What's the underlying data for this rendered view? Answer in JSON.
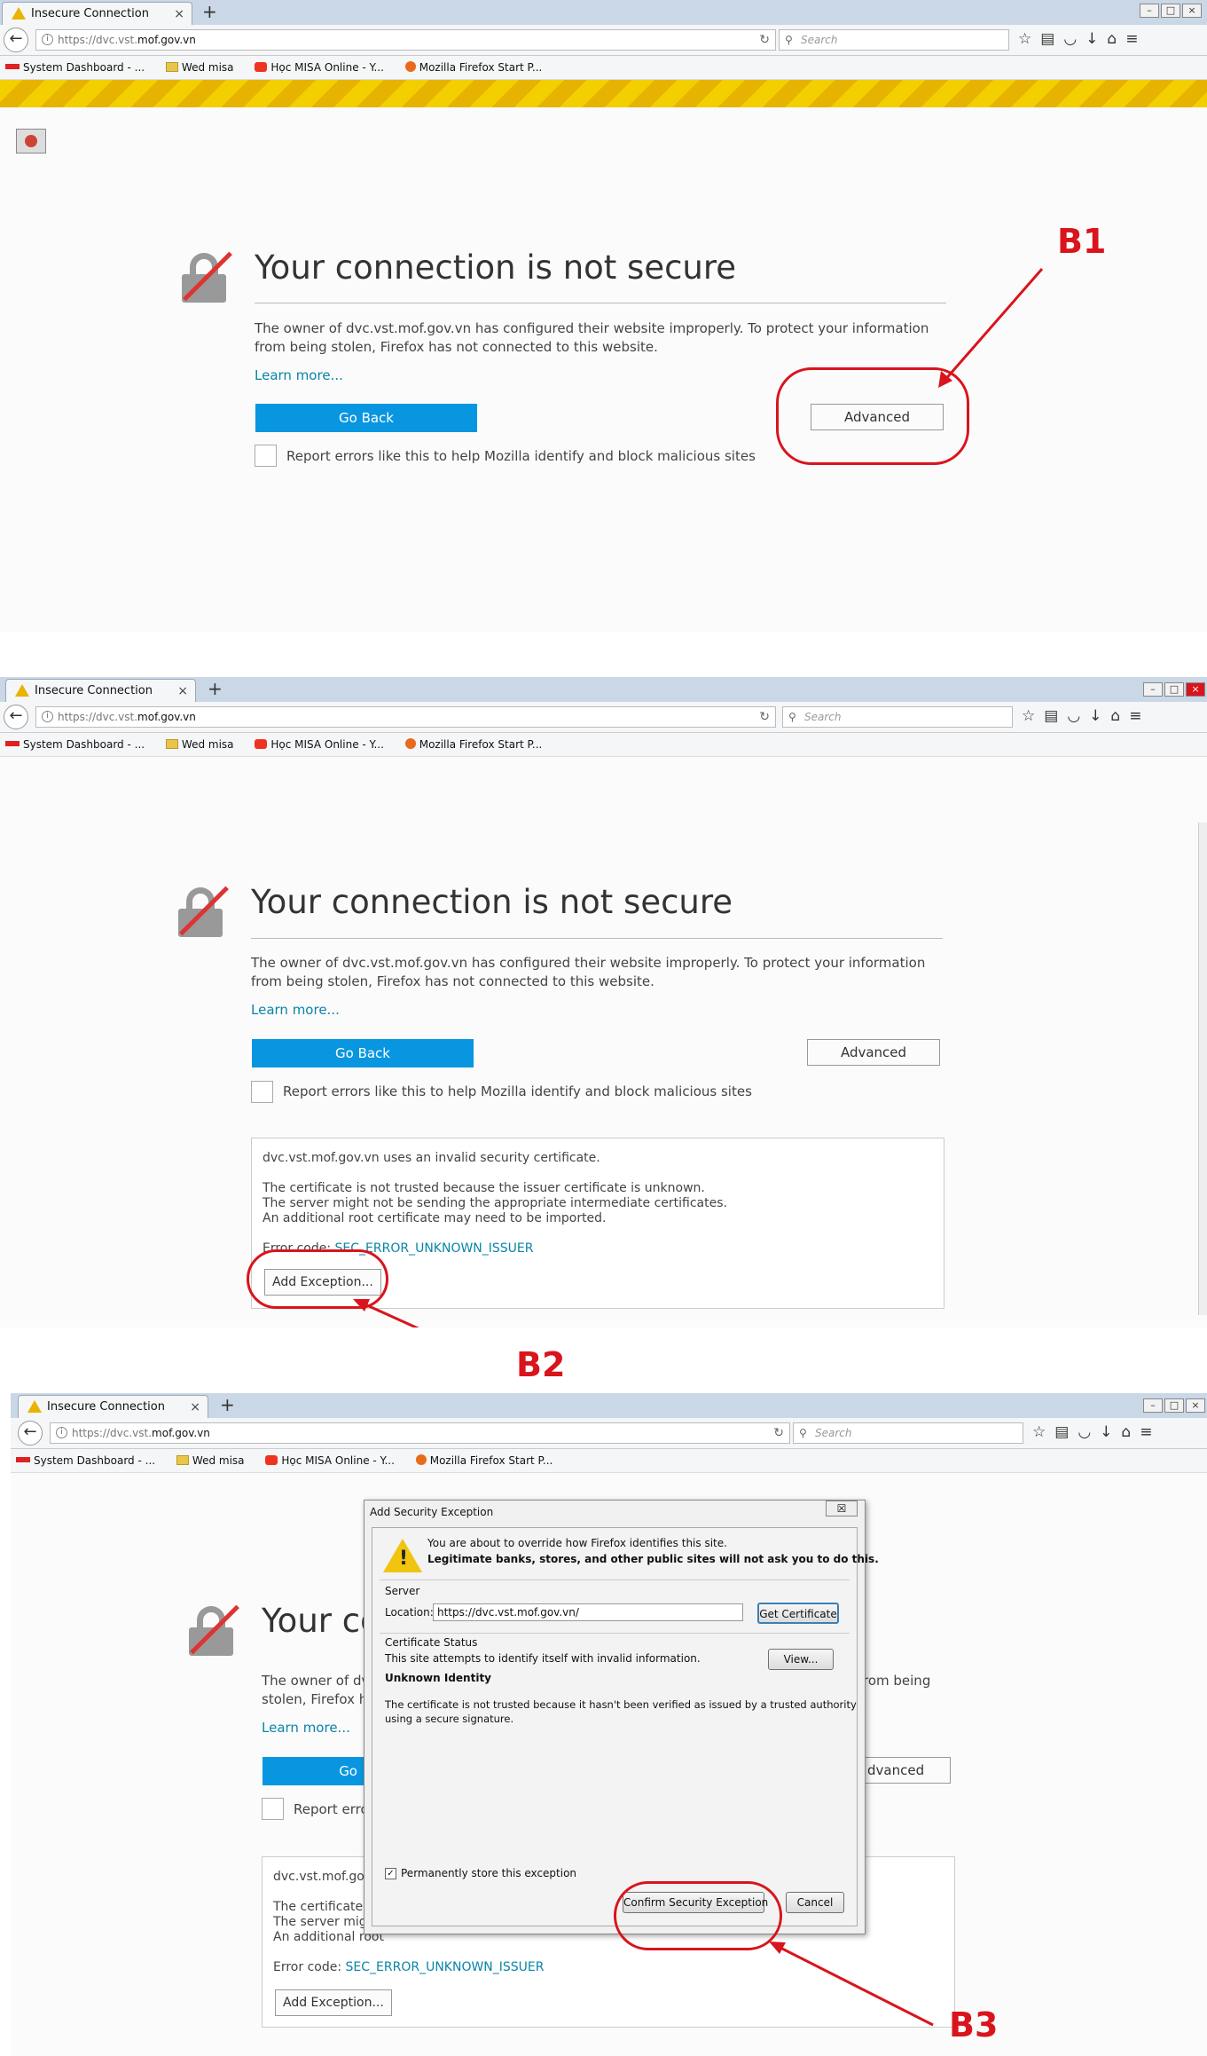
{
  "browser": {
    "tab_title": "Insecure Connection",
    "tab_close": "×",
    "new_tab": "+",
    "url_prefix": "https://dvc.vst.",
    "url_host": "mof.gov.vn",
    "search_placeholder": "Search",
    "bookmarks": [
      {
        "label": "System Dashboard - ...",
        "icon": "misa-icon"
      },
      {
        "label": "Wed misa",
        "icon": "folder-icon"
      },
      {
        "label": "Học MISA Online - Y...",
        "icon": "youtube-icon"
      },
      {
        "label": "Mozilla Firefox Start P...",
        "icon": "firefox-icon"
      }
    ]
  },
  "error_page": {
    "title": "Your connection is not secure",
    "title_truncated": "Your co",
    "description": "The owner of dvc.vst.mof.gov.vn has configured their website improperly. To protect your information from being stolen, Firefox has not connected to this website.",
    "desc_line1_trunc": "The owner of dvc",
    "desc_line1_end": "rom being",
    "desc_line2_trunc": "stolen, Firefox ha",
    "learn_more": "Learn more...",
    "go_back": "Go Back",
    "go_back_trunc": "Go",
    "advanced": "Advanced",
    "advanced_trunc": "dvanced",
    "report_label": "Report errors like this to help Mozilla identify and block malicious sites",
    "report_trunc": "Report error"
  },
  "cert_details": {
    "line1": "dvc.vst.mof.gov.vn uses an invalid security certificate.",
    "line1_trunc": "dvc.vst.mof.gov",
    "line2": "The certificate is not trusted because the issuer certificate is unknown.",
    "line2_trunc": "The certificate is",
    "line3": "The server might not be sending the appropriate intermediate certificates.",
    "line3_trunc": "The server might",
    "line4": "An additional root certificate may need to be imported.",
    "line4_trunc": "An additional root",
    "error_code_label": "Error code:",
    "error_code": "SEC_ERROR_UNKNOWN_ISSUER",
    "add_exception": "Add Exception..."
  },
  "dialog": {
    "title": "Add Security Exception",
    "close": "☒",
    "warning_line1": "You are about to override how Firefox identifies this site.",
    "warning_line2": "Legitimate banks, stores, and other public sites will not ask you to do this.",
    "server_label": "Server",
    "location_label": "Location:",
    "location_value": "https://dvc.vst.mof.gov.vn/",
    "get_certificate": "Get Certificate",
    "cert_status_label": "Certificate Status",
    "status_text": "This site attempts to identify itself with invalid information.",
    "view_button": "View...",
    "unknown_identity": "Unknown Identity",
    "identity_desc_1": "The certificate is not trusted because it hasn't been verified as issued by a trusted authority",
    "identity_desc_2": "using a secure signature.",
    "permanent_label": "Permanently store this exception",
    "permanent_checked": "✓",
    "confirm": "Confirm Security Exception",
    "cancel": "Cancel"
  },
  "annotations": {
    "b1": "B1",
    "b2": "B2",
    "b3": "B3"
  },
  "colors": {
    "annotation_red": "#d9141c",
    "primary_button_blue": "#0996e0",
    "link_blue": "#0a84a8",
    "warning_stripe": "#f3cf00"
  }
}
